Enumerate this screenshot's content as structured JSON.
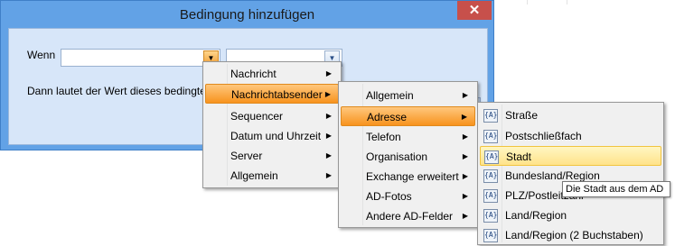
{
  "dialog": {
    "title": "Bedingung hinzufügen",
    "close_label": "✕",
    "wenn_label": "Wenn",
    "field_value": "",
    "operator_value": "",
    "dropdown_arrow": "▼",
    "dann_label": "Dann lautet der Wert dieses bedingten Fe"
  },
  "menu1": {
    "items": [
      {
        "label": "Nachricht",
        "submenu": true
      },
      {
        "label": "Nachrichtabsender",
        "submenu": true,
        "highlighted": true
      },
      {
        "label": "Sequencer",
        "submenu": true
      },
      {
        "label": "Datum und Uhrzeit",
        "submenu": true
      },
      {
        "label": "Server",
        "submenu": true
      },
      {
        "label": "Allgemein",
        "submenu": true
      }
    ]
  },
  "menu2": {
    "items": [
      {
        "label": "Allgemein",
        "submenu": true
      },
      {
        "label": "Adresse",
        "submenu": true,
        "highlighted": true
      },
      {
        "label": "Telefon",
        "submenu": true
      },
      {
        "label": "Organisation",
        "submenu": true
      },
      {
        "label": "Exchange erweitert",
        "submenu": true
      },
      {
        "label": "AD-Fotos",
        "submenu": true
      },
      {
        "label": "Andere AD-Felder",
        "submenu": true
      }
    ]
  },
  "menu3": {
    "icon_text": "{A}",
    "items": [
      {
        "label": "Straße"
      },
      {
        "label": "Postschließfach"
      },
      {
        "label": "Stadt",
        "highlighted": true
      },
      {
        "label": "Bundesland/Region"
      },
      {
        "label": "PLZ/Postleitzahl"
      },
      {
        "label": "Land/Region"
      },
      {
        "label": "Land/Region (2 Buchstaben)"
      }
    ]
  },
  "submenu_arrow": "▶",
  "tooltip": "Die Stadt aus dem AD",
  "colors": {
    "title_bar": "#62a2e6",
    "close_button": "#c7504b",
    "highlight_orange": "#f7931e",
    "highlight_yellow": "#ffe38a"
  }
}
